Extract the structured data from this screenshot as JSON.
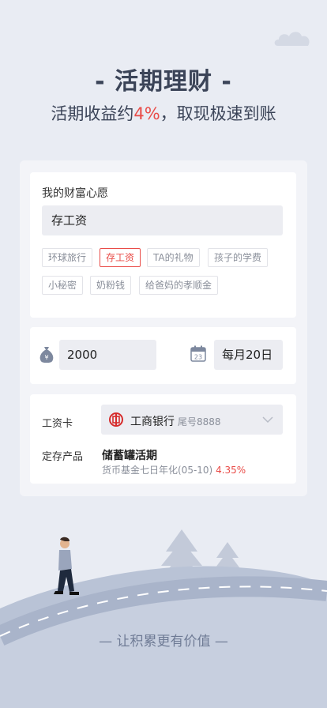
{
  "hero": {
    "title": "- 活期理财 -",
    "subtitle_prefix": "活期收益约",
    "subtitle_rate": "4%",
    "subtitle_suffix": "，取现极速到账"
  },
  "wish": {
    "title": "我的财富心愿",
    "input_value": "存工资",
    "tags": [
      "环球旅行",
      "存工资",
      "TA的礼物",
      "孩子的学费",
      "小秘密",
      "奶粉钱",
      "给爸妈的孝顺金"
    ],
    "active_tag": "存工资"
  },
  "plan": {
    "amount": "2000",
    "date": "每月20日",
    "calendar_day": "23"
  },
  "account": {
    "card_label": "工资卡",
    "bank_name": "工商银行",
    "bank_tail": "尾号8888",
    "product_label": "定存产品",
    "product_name": "储蓄罐活期",
    "product_desc": "货币基金七日年化(05-10)",
    "product_rate": "4.35%"
  },
  "footer": {
    "slogan": "— 让积累更有价值 —"
  },
  "colors": {
    "accent": "#e94c48",
    "title": "#3b4458",
    "background": "#e9ecf3"
  }
}
